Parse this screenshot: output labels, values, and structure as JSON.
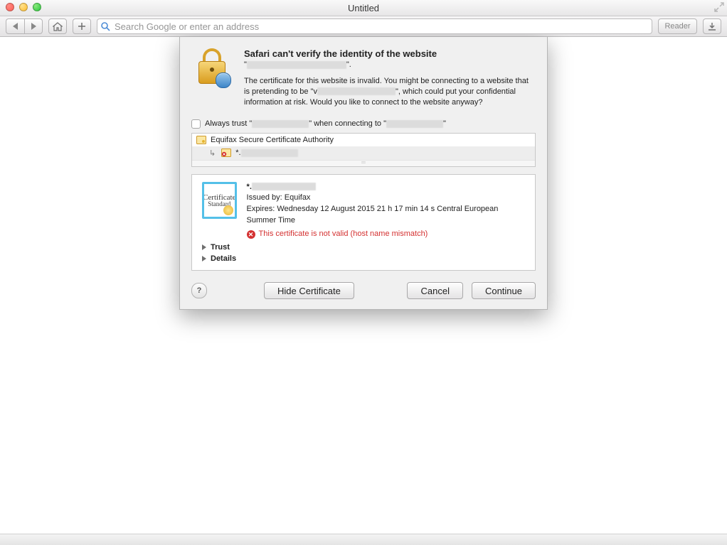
{
  "window": {
    "title": "Untitled"
  },
  "toolbar": {
    "placeholder": "Search Google or enter an address",
    "reader_label": "Reader"
  },
  "dialog": {
    "heading": "Safari can't verify the identity of the website",
    "warning": "The certificate for this website is invalid. You might be connecting to a website that is pretending to be \"",
    "warning2": "\", which could put your confidential information at risk. Would you like to connect to the website anyway?",
    "always_trust_pre": "Always trust \"",
    "always_trust_mid": "\" when connecting to \"",
    "always_trust_post": "\"",
    "chain": {
      "root": "Equifax Secure Certificate Authority",
      "leaf_prefix": "*."
    },
    "cert": {
      "name_prefix": "*.",
      "issued_by": "Issued by: Equifax",
      "expires": "Expires: Wednesday 12 August 2015 21 h 17 min 14 s Central European Summer Time",
      "invalid": "This certificate is not valid (host name mismatch)",
      "img_line1": "Certificate",
      "img_line2": "Standard"
    },
    "disclosure": {
      "trust": "Trust",
      "details": "Details"
    },
    "buttons": {
      "hide_cert": "Hide Certificate",
      "cancel": "Cancel",
      "continue": "Continue"
    }
  }
}
